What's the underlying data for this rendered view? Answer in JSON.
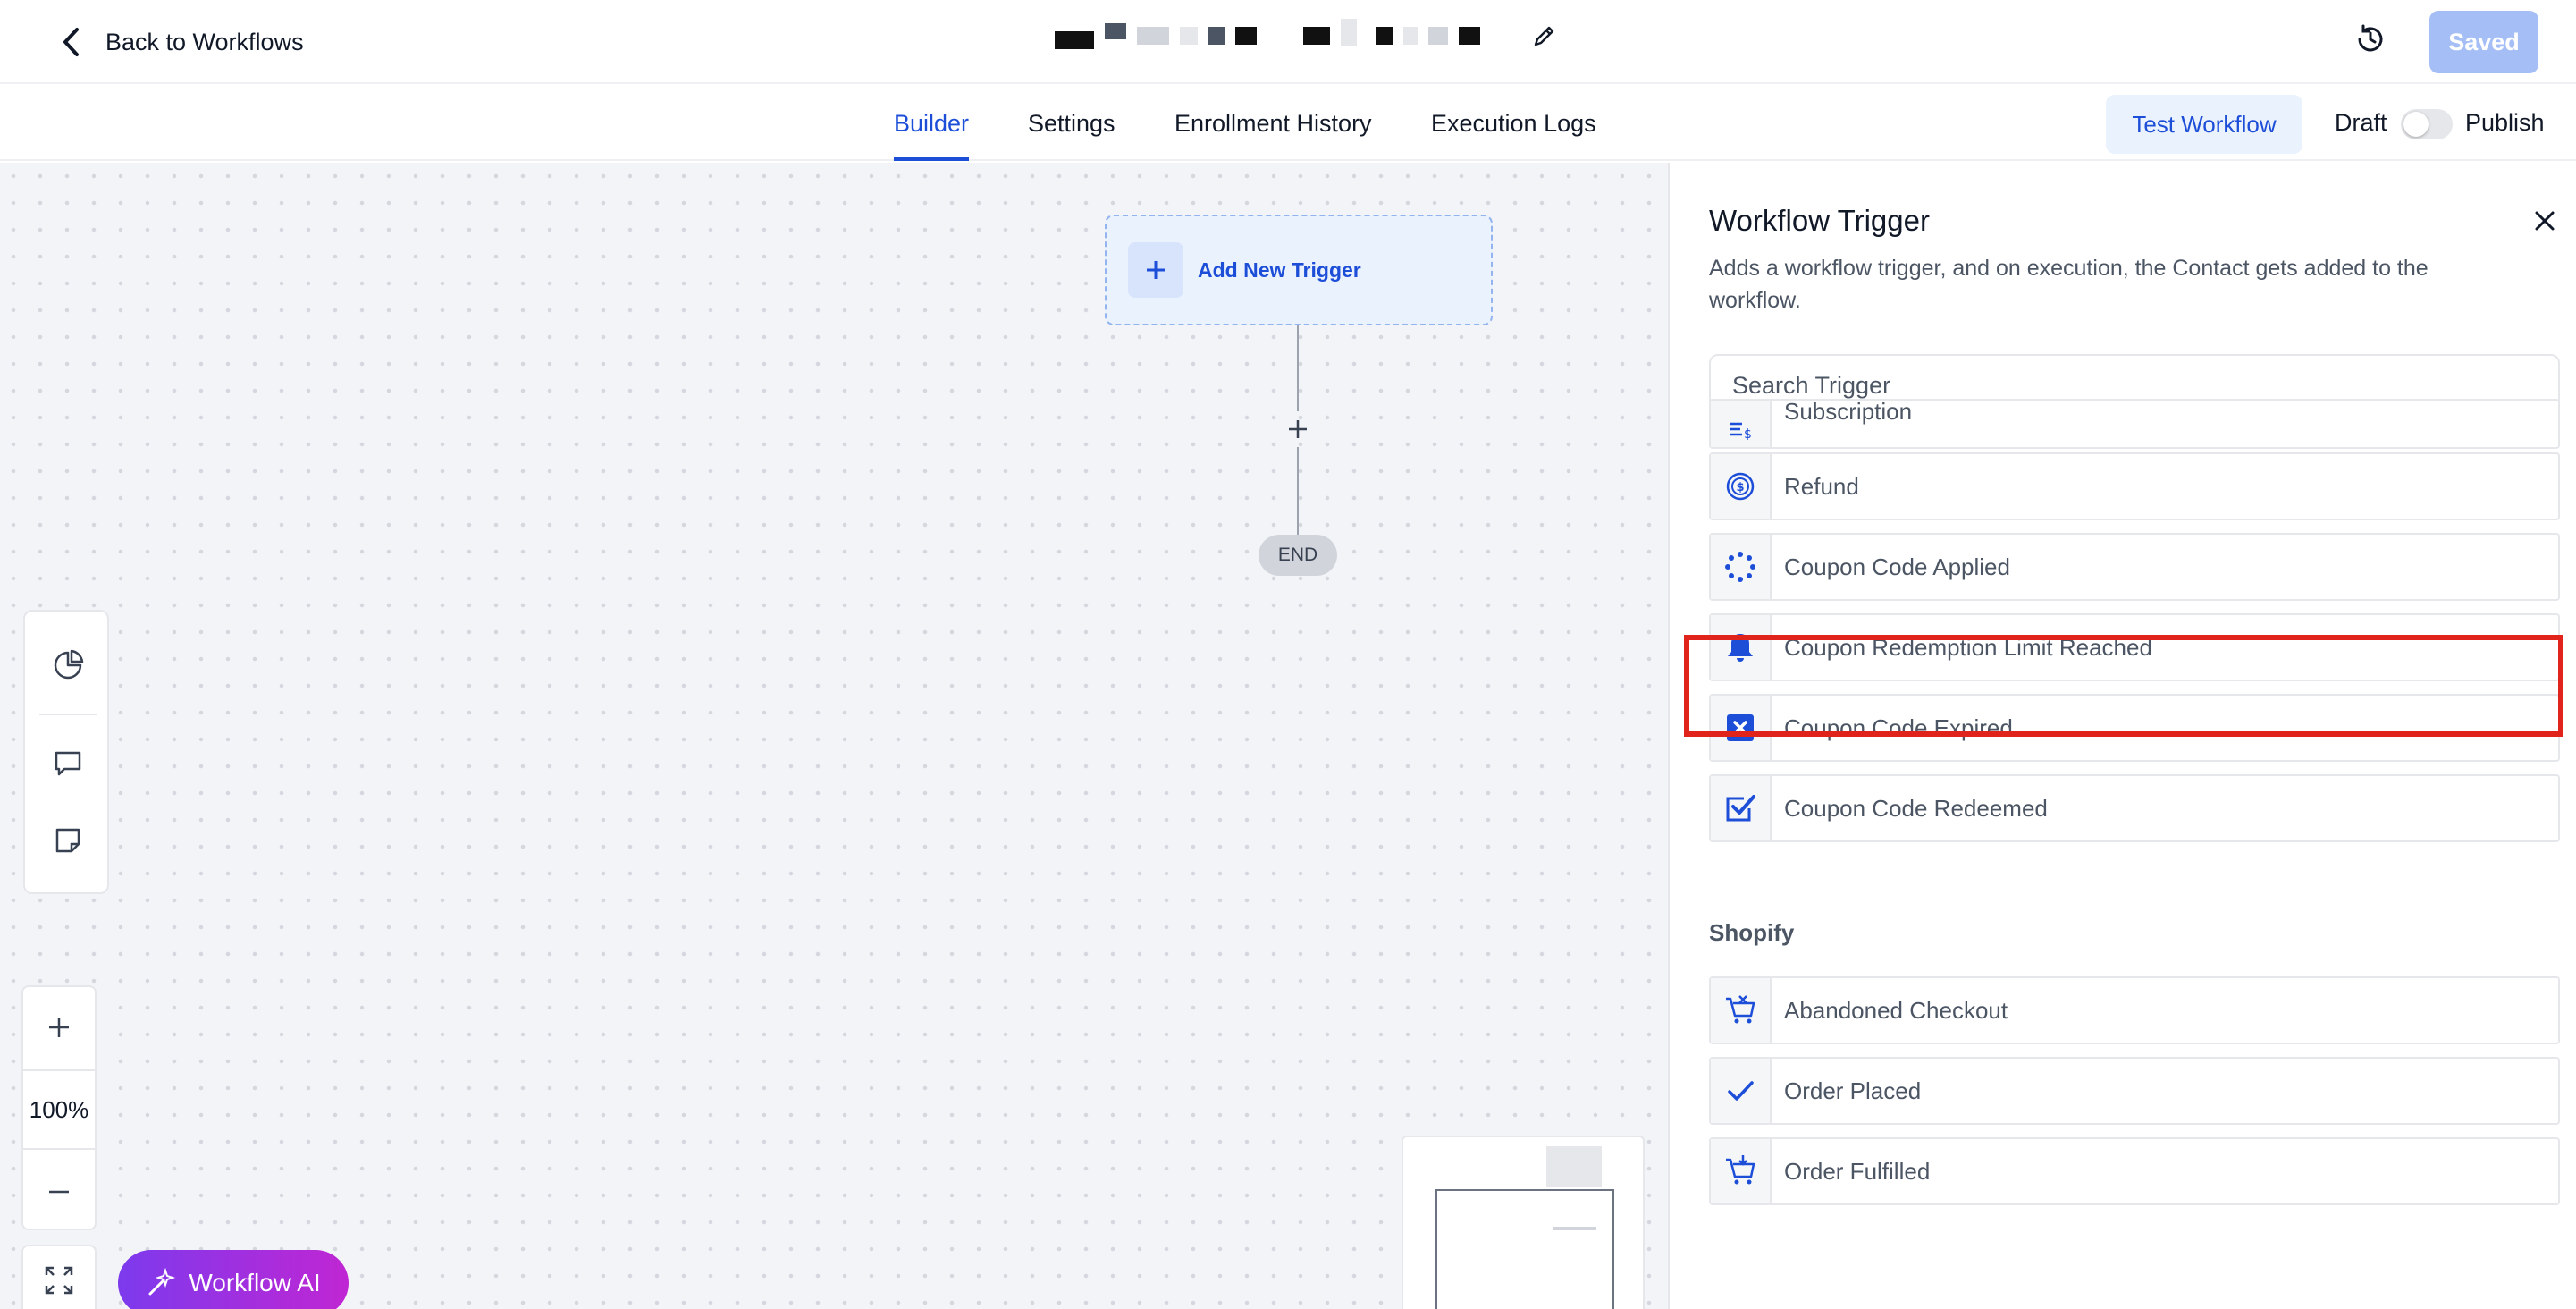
{
  "header": {
    "back_label": "Back to Workflows",
    "saved_label": "Saved"
  },
  "tabs": [
    {
      "label": "Builder",
      "active": true
    },
    {
      "label": "Settings",
      "active": false
    },
    {
      "label": "Enrollment History",
      "active": false
    },
    {
      "label": "Execution Logs",
      "active": false
    }
  ],
  "actions": {
    "test_workflow_label": "Test Workflow",
    "draft_label": "Draft",
    "publish_label": "Publish",
    "publish_toggle_on": false
  },
  "canvas": {
    "add_trigger_label": "Add New Trigger",
    "end_label": "END",
    "zoom_level": "100%",
    "ai_button_label": "Workflow AI"
  },
  "panel": {
    "title": "Workflow Trigger",
    "description": "Adds a workflow trigger, and on execution, the Contact gets added to the workflow.",
    "search_placeholder": "Search Trigger",
    "items": [
      {
        "label": "Subscription",
        "icon": "subscription-icon"
      },
      {
        "label": "Refund",
        "icon": "refund-icon"
      },
      {
        "label": "Coupon Code Applied",
        "icon": "loading-dots-icon"
      },
      {
        "label": "Coupon Redemption Limit Reached",
        "icon": "bell-icon"
      },
      {
        "label": "Coupon Code Expired",
        "icon": "x-square-icon"
      },
      {
        "label": "Coupon Code Redeemed",
        "icon": "check-square-icon"
      }
    ],
    "shopify_header": "Shopify",
    "shopify_items": [
      {
        "label": "Abandoned Checkout",
        "icon": "cart-x-icon"
      },
      {
        "label": "Order Placed",
        "icon": "check-icon"
      },
      {
        "label": "Order Fulfilled",
        "icon": "cart-down-icon"
      }
    ]
  },
  "colors": {
    "accent": "#1d4ed8",
    "highlight": "#e0231b",
    "ai_gradient_start": "#7c3aed",
    "ai_gradient_end": "#c026d3"
  }
}
